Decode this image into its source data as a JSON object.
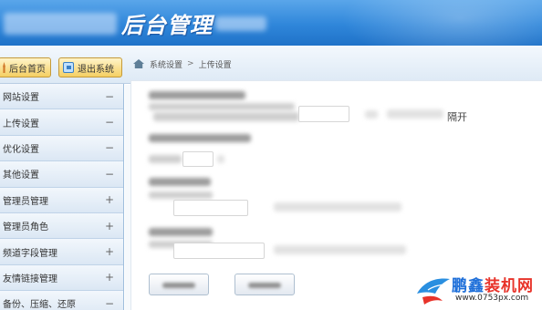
{
  "header": {
    "title": "后台管理"
  },
  "topbar": {
    "home_button": "后台首页",
    "exit_button": "退出系统"
  },
  "breadcrumb": {
    "items": [
      "系统设置",
      "上传设置"
    ],
    "separator": ">"
  },
  "sidebar": {
    "items": [
      {
        "label": "网站设置",
        "toggle": "−"
      },
      {
        "label": "上传设置",
        "toggle": "−"
      },
      {
        "label": "优化设置",
        "toggle": "−"
      },
      {
        "label": "其他设置",
        "toggle": "−"
      },
      {
        "label": "管理员管理",
        "toggle": "+"
      },
      {
        "label": "管理员角色",
        "toggle": "+"
      },
      {
        "label": "频道字段管理",
        "toggle": "+"
      },
      {
        "label": "友情链接管理",
        "toggle": "+"
      },
      {
        "label": "备份、压缩、还原",
        "toggle": "−"
      }
    ]
  },
  "content": {
    "trailing_text": "隔开"
  },
  "watermark": {
    "brand_prefix": "鹏鑫",
    "brand_suffix": "装机网",
    "url": "www.0753px.com"
  },
  "colors": {
    "header_blue": "#2f86da",
    "button_gold": "#f5cf63",
    "sidebar_bg": "#e3eef9",
    "watermark_blue": "#1e6fd9",
    "watermark_red": "#e8332a"
  }
}
